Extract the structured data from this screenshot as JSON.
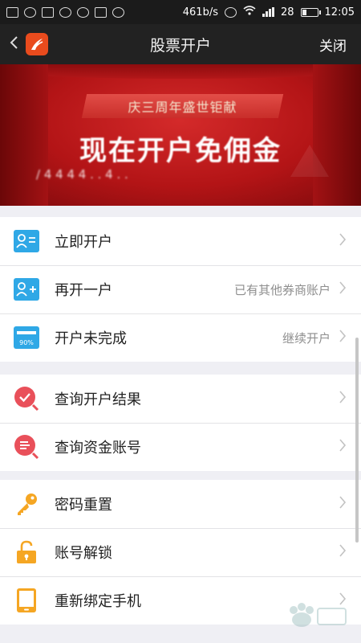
{
  "status_bar": {
    "network_speed": "461b/s",
    "battery_level": "28",
    "time": "12:05"
  },
  "nav": {
    "title": "股票开户",
    "close_label": "关闭"
  },
  "banner": {
    "subtitle": "庆三周年盛世钜献",
    "headline": "现在开户免佣金",
    "note": "/ 4 4 4 4 . . 4 . ."
  },
  "menu_groups": [
    {
      "items": [
        {
          "label": "立即开户",
          "hint": "",
          "icon": "person-card-icon"
        },
        {
          "label": "再开一户",
          "hint": "已有其他券商账户",
          "icon": "add-person-icon"
        },
        {
          "label": "开户未完成",
          "hint": "继续开户",
          "icon": "progress-card-icon",
          "icon_text": "90%"
        }
      ]
    },
    {
      "items": [
        {
          "label": "查询开户结果",
          "hint": "",
          "icon": "check-search-icon"
        },
        {
          "label": "查询资金账号",
          "hint": "",
          "icon": "list-search-icon"
        }
      ]
    },
    {
      "items": [
        {
          "label": "密码重置",
          "hint": "",
          "icon": "key-icon"
        },
        {
          "label": "账号解锁",
          "hint": "",
          "icon": "unlock-icon"
        },
        {
          "label": "重新绑定手机",
          "hint": "",
          "icon": "phone-icon"
        }
      ]
    }
  ],
  "colors": {
    "icon_blue": "#2fa8e6",
    "icon_red": "#e9505a",
    "icon_orange": "#f5a623",
    "banner_red": "#c41d1f"
  }
}
